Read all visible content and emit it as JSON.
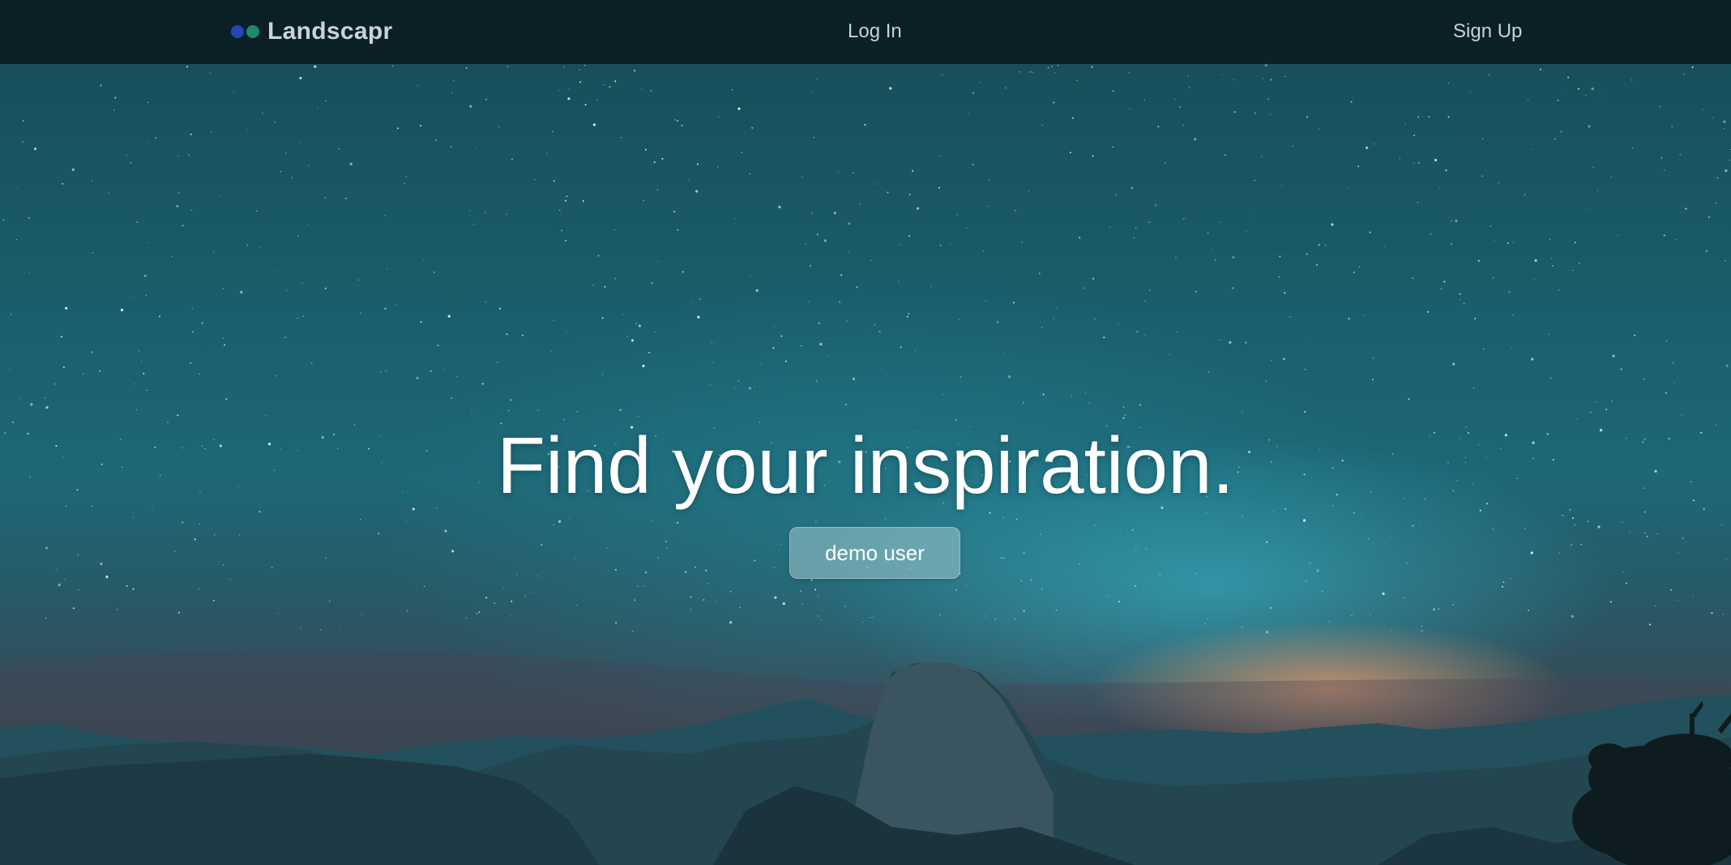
{
  "navbar": {
    "brand_name": "Landscapr",
    "brand_dot_colors": [
      "#2346b8",
      "#1f8a6c"
    ],
    "login_label": "Log In",
    "signup_label": "Sign Up"
  },
  "hero": {
    "title": "Find your inspiration.",
    "demo_button_label": "demo user"
  },
  "colors": {
    "navbar_bg": "#0b161a",
    "sky_top": "#174a57",
    "sky_glow": "#3cbed2",
    "horizon_glow": "#eba06e"
  }
}
